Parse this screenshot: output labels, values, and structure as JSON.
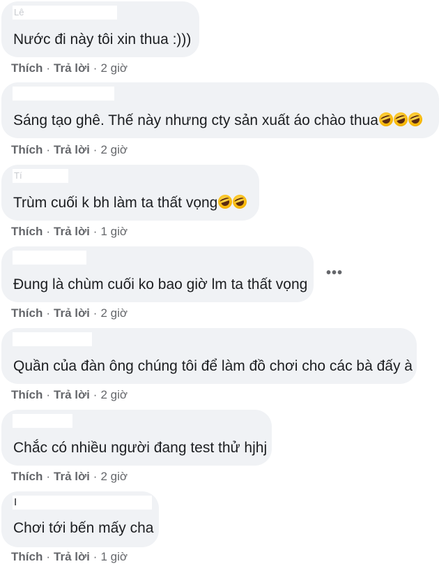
{
  "comments": [
    {
      "name": "Lê",
      "text": "Nước đi này tôi xin thua :)))",
      "emoji_count": 0,
      "like": "Thích",
      "reply": "Trả lời",
      "time": "2 giờ"
    },
    {
      "name": "",
      "text": "Sáng tạo ghê. Thế này nhưng cty sản xuất áo chào thua",
      "emoji_count": 3,
      "like": "Thích",
      "reply": "Trả lời",
      "time": "2 giờ"
    },
    {
      "name": "Tí",
      "text": "Trùm cuối k bh làm ta thất vọng",
      "emoji_count": 2,
      "like": "Thích",
      "reply": "Trả lời",
      "time": "1 giờ"
    },
    {
      "name": "",
      "text": "Đung là chùm cuối ko bao giờ lm ta thất vọng",
      "emoji_count": 0,
      "like": "Thích",
      "reply": "Trả lời",
      "time": "2 giờ"
    },
    {
      "name": "",
      "text": "Quần của đàn ông chúng tôi để làm đồ chơi cho các bà đấy à",
      "emoji_count": 0,
      "like": "Thích",
      "reply": "Trả lời",
      "time": "2 giờ"
    },
    {
      "name": "",
      "text": "Chắc có nhiều người đang test thử hjhj",
      "emoji_count": 0,
      "like": "Thích",
      "reply": "Trả lời",
      "time": "2 giờ"
    },
    {
      "name": "I",
      "text": "Chơi tới bến mấy cha",
      "emoji_count": 0,
      "like": "Thích",
      "reply": "Trả lời",
      "time": "1 giờ"
    }
  ],
  "more_icon": "more-options-icon",
  "more_glyph": "•••",
  "emoji_icon": "rolling-on-floor-laughing-icon",
  "colors": {
    "bubble": "#f0f2f5",
    "text": "#1c1e21",
    "meta": "#65676b"
  }
}
